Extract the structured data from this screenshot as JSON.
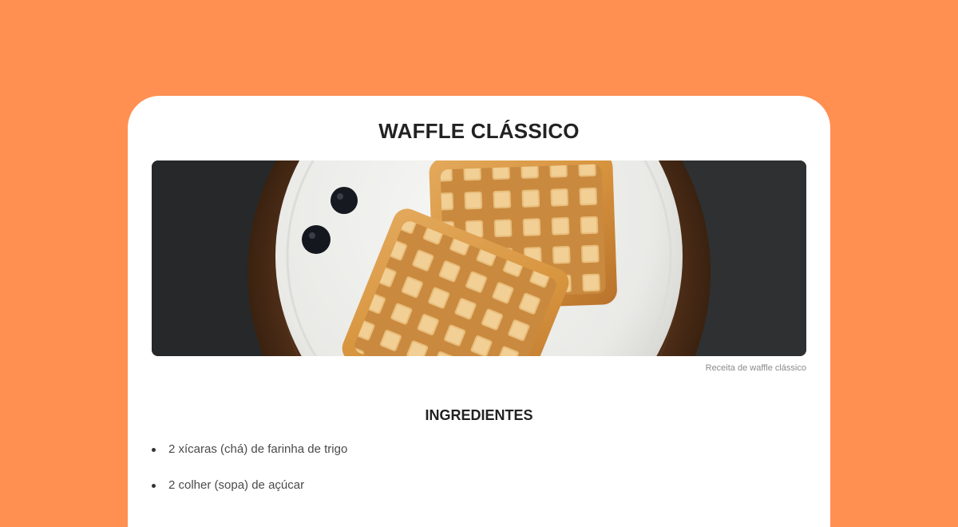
{
  "recipe": {
    "title": "WAFFLE CLÁSSICO",
    "image_alt": "Receita de waffle clássico",
    "caption": "Receita de waffle clássico",
    "ingredients_heading": "INGREDIENTES",
    "ingredients": [
      "2 xícaras (chá) de farinha de trigo",
      "2 colher (sopa) de açúcar"
    ]
  },
  "colors": {
    "background": "#FF9052",
    "card": "#FFFFFF",
    "heading_text": "#222222",
    "body_text": "#4A4A4A",
    "caption_text": "#8A8A8A"
  }
}
